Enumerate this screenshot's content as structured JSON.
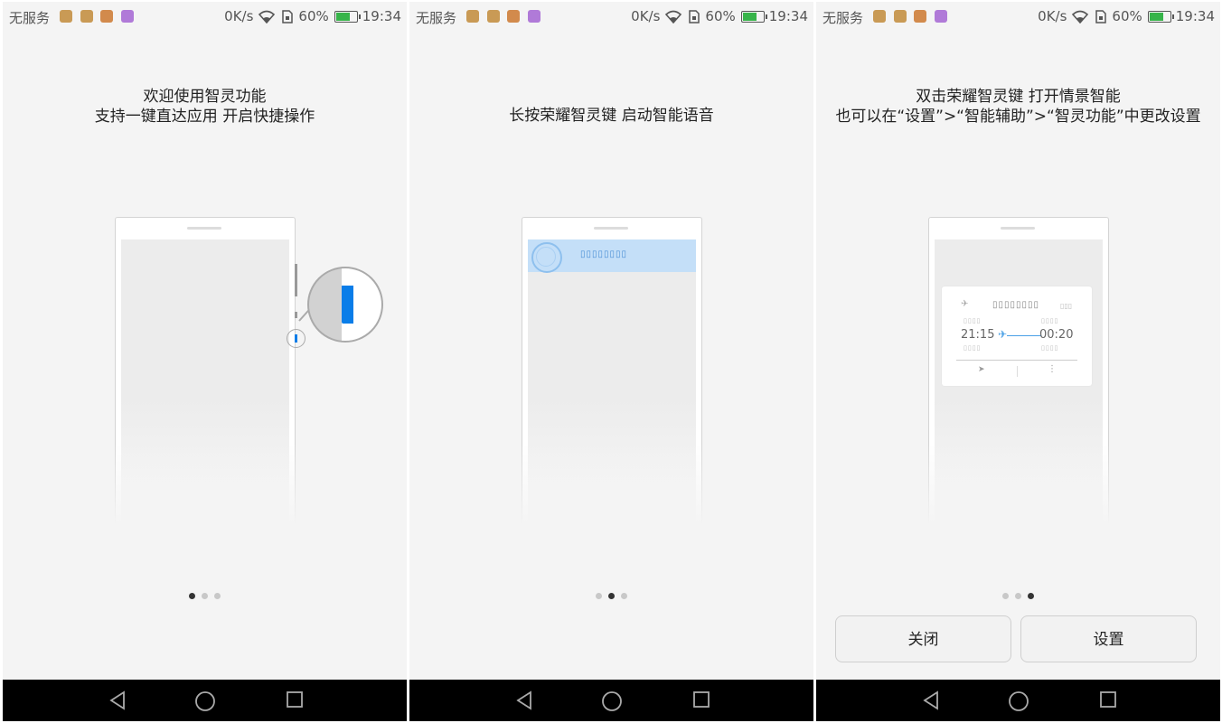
{
  "status_bar": {
    "carrier": "无服务",
    "speed": "0K/s",
    "battery_percent": "60%",
    "time": "19:34"
  },
  "screens": [
    {
      "title_lines": [
        "欢迎使用智灵功能",
        "支持一键直达应用 开启快捷操作"
      ],
      "page_index": 0
    },
    {
      "title_lines": [
        "长按荣耀智灵键 启动智能语音"
      ],
      "voice_text": "▯▯▯▯▯▯▯▯",
      "page_index": 1
    },
    {
      "title_lines": [
        "双击荣耀智灵键 打开情景智能",
        "也可以在“设置”>“智能辅助”>“智灵功能”中更改设置"
      ],
      "card": {
        "title": "▯▯▯▯▯▯▯▯",
        "depart_time": "21:15",
        "arrive_time": "00:20"
      },
      "buttons": {
        "close": "关闭",
        "settings": "设置"
      },
      "page_index": 2
    }
  ],
  "page_count": 3,
  "icons": [
    "wifi-icon",
    "sim-icon",
    "battery-icon",
    "back-icon",
    "home-icon",
    "recents-icon"
  ],
  "colors": {
    "accent_blue": "#0a7de8",
    "voice_highlight": "#c4dff8",
    "battery_green": "#37b44a"
  }
}
